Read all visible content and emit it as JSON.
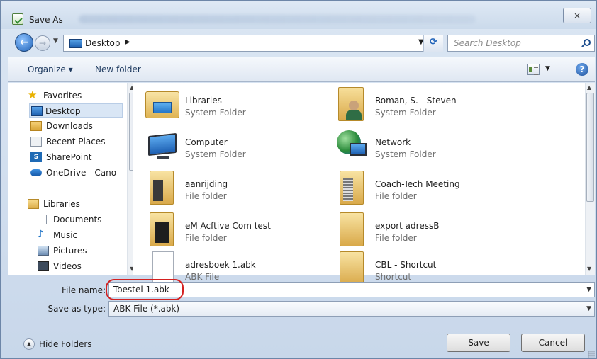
{
  "window": {
    "title": "Save As",
    "close_glyph": "⨯"
  },
  "address_bar": {
    "location": "Desktop",
    "search_placeholder": "Search Desktop"
  },
  "toolbar": {
    "organize": "Organize ▾",
    "new_folder": "New folder",
    "help": "?"
  },
  "nav_pane": {
    "items": [
      {
        "label": "Favorites",
        "icon": "star-icon"
      },
      {
        "label": "Desktop",
        "icon": "desktop-icon",
        "selected": true
      },
      {
        "label": "Downloads",
        "icon": "downloads-icon"
      },
      {
        "label": "Recent Places",
        "icon": "recent-places-icon"
      },
      {
        "label": "SharePoint",
        "icon": "sharepoint-icon"
      },
      {
        "label": "OneDrive - Cano",
        "icon": "onedrive-icon"
      },
      {
        "label": "Libraries",
        "icon": "libraries-icon"
      },
      {
        "label": "Documents",
        "icon": "documents-icon"
      },
      {
        "label": "Music",
        "icon": "music-icon"
      },
      {
        "label": "Pictures",
        "icon": "pictures-icon"
      },
      {
        "label": "Videos",
        "icon": "videos-icon"
      }
    ]
  },
  "files": [
    {
      "name": "Libraries",
      "type": "System Folder",
      "icon": "libraries-folder-icon"
    },
    {
      "name": "Roman, S. - Steven -",
      "type": "System Folder",
      "icon": "user-folder-icon"
    },
    {
      "name": "Computer",
      "type": "System Folder",
      "icon": "computer-icon"
    },
    {
      "name": "Network",
      "type": "System Folder",
      "icon": "network-icon"
    },
    {
      "name": "aanrijding",
      "type": "File folder",
      "icon": "folder-icon"
    },
    {
      "name": "Coach-Tech Meeting",
      "type": "File folder",
      "icon": "folder-icon"
    },
    {
      "name": "eM Acftive Com test",
      "type": "File folder",
      "icon": "folder-icon"
    },
    {
      "name": "export adressB",
      "type": "File folder",
      "icon": "folder-icon"
    },
    {
      "name": "adresboek 1.abk",
      "type": "ABK File",
      "icon": "file-icon"
    },
    {
      "name": "CBL - Shortcut",
      "type": "Shortcut",
      "icon": "shortcut-folder-icon"
    }
  ],
  "form": {
    "file_name_label": "File name:",
    "file_name_value": "Toestel 1.abk",
    "save_type_label": "Save as type:",
    "save_type_value": "ABK File (*.abk)"
  },
  "footer": {
    "hide_folders": "Hide Folders",
    "save": "Save",
    "cancel": "Cancel"
  }
}
